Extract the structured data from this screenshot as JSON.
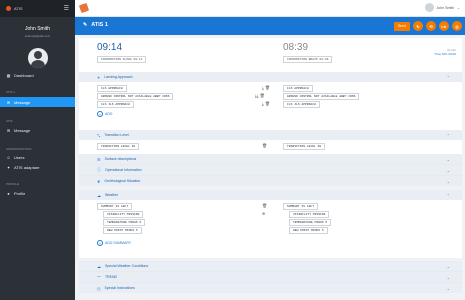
{
  "app": {
    "title": "ATIS"
  },
  "sidebar": {
    "user_name": "John Smith",
    "user_email": "example@atis.com",
    "sections": [
      "ATIS 1",
      "ATIS",
      "ADMINISTRATION",
      "PROFILE"
    ],
    "items": [
      {
        "label": "Dashboard",
        "icon": "dashboard-icon"
      },
      {
        "label": "Message",
        "icon": "message-icon"
      },
      {
        "label": "Message",
        "icon": "message-icon"
      },
      {
        "label": "Users",
        "icon": "users-icon"
      },
      {
        "label": "ATIS adaptare",
        "icon": "settings-icon"
      },
      {
        "label": "Profile",
        "icon": "profile-icon"
      }
    ]
  },
  "topbar": {
    "user_label": "John Smith"
  },
  "titlebar": {
    "title": "ATIS 1",
    "send_label": "Send",
    "circle_buttons": [
      "↻",
      "⟲",
      "Ltr",
      "◎"
    ]
  },
  "time": {
    "left_time": "09:14",
    "left_info": "INFORMATION ALPHA 09:14",
    "right_time": "08:39",
    "right_info": "INFORMATION BRAVO 08:39",
    "meta_small": "ID abc",
    "meta_label": "Time NPL 09:00"
  },
  "landing": {
    "title": "Landing Approach",
    "left_chips": [
      "ILS APPROACH",
      "GROUND CONTROL NOT AVAILABLE ABBY CRSS",
      "ILS ILS APPROACH"
    ],
    "right_chips": [
      "ILS APPROACH",
      "GROUND CONTROL NOT AVAILABLE ABBY CRSS",
      "ILS ILS APPROACH"
    ],
    "add_label": "ADD"
  },
  "transition": {
    "title": "Transition Level",
    "left_chip": "TRANSITION LEVEL 60",
    "right_chip": "TRANSITION LEVEL 60"
  },
  "collapsed": [
    {
      "title": "Surface descriptions",
      "icon": "list-icon"
    },
    {
      "title": "Operational Information",
      "icon": "info-icon"
    },
    {
      "title": "Ornithological Situation",
      "icon": "bird-icon"
    }
  ],
  "weather": {
    "title": "Weather",
    "left_chips": [
      "SUMMARY IS LEFT",
      "VISIBILITY MISSING",
      "TEMPERATURE MINUS 5",
      "DEW POINT MINUS 5"
    ],
    "right_chips": [
      "SUMMARY IS LEFT",
      "VISIBILITY MISSING",
      "TEMPERATURE MINUS 5",
      "DEW POINT MINUS 5"
    ],
    "add_label": "ADD SUMMARY"
  },
  "bottom": [
    {
      "title": "Special Weather Conditions",
      "icon": "cloud-icon"
    },
    {
      "title": "TREND",
      "icon": "trend-icon"
    },
    {
      "title": "Special Instructions",
      "icon": "clock-icon"
    }
  ]
}
